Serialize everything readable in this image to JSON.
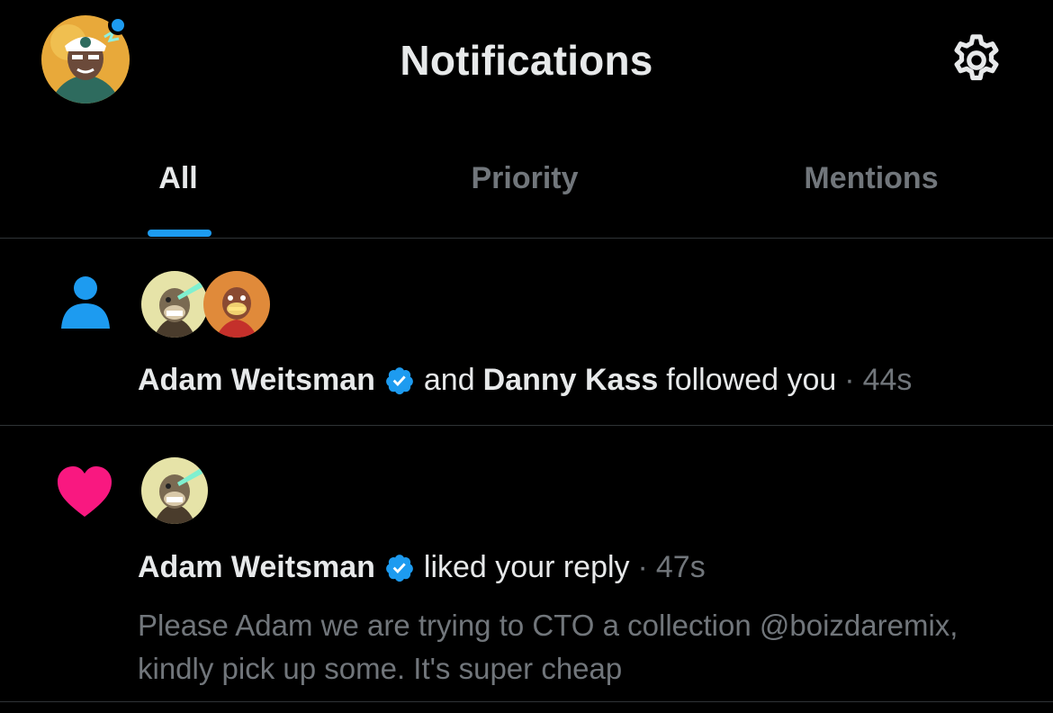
{
  "header": {
    "title": "Notifications",
    "accent_color": "#1d9bf0"
  },
  "tabs": [
    {
      "label": "All",
      "active": true
    },
    {
      "label": "Priority",
      "active": false
    },
    {
      "label": "Mentions",
      "active": false
    }
  ],
  "notifications": [
    {
      "type": "follow",
      "icon": "person-icon",
      "icon_color": "#1d9bf0",
      "user1": "Adam Weitsman",
      "user1_verified": true,
      "connector": "and",
      "user2": "Danny Kass",
      "action": "followed you",
      "separator": "·",
      "time": "44s"
    },
    {
      "type": "like",
      "icon": "heart-icon",
      "icon_color": "#f91880",
      "user1": "Adam Weitsman",
      "user1_verified": true,
      "action": "liked your reply",
      "separator": "·",
      "time": "47s",
      "reply_text": "Please Adam we are trying to CTO a collection @boizdaremix, kindly pick up some. It's super cheap"
    }
  ]
}
